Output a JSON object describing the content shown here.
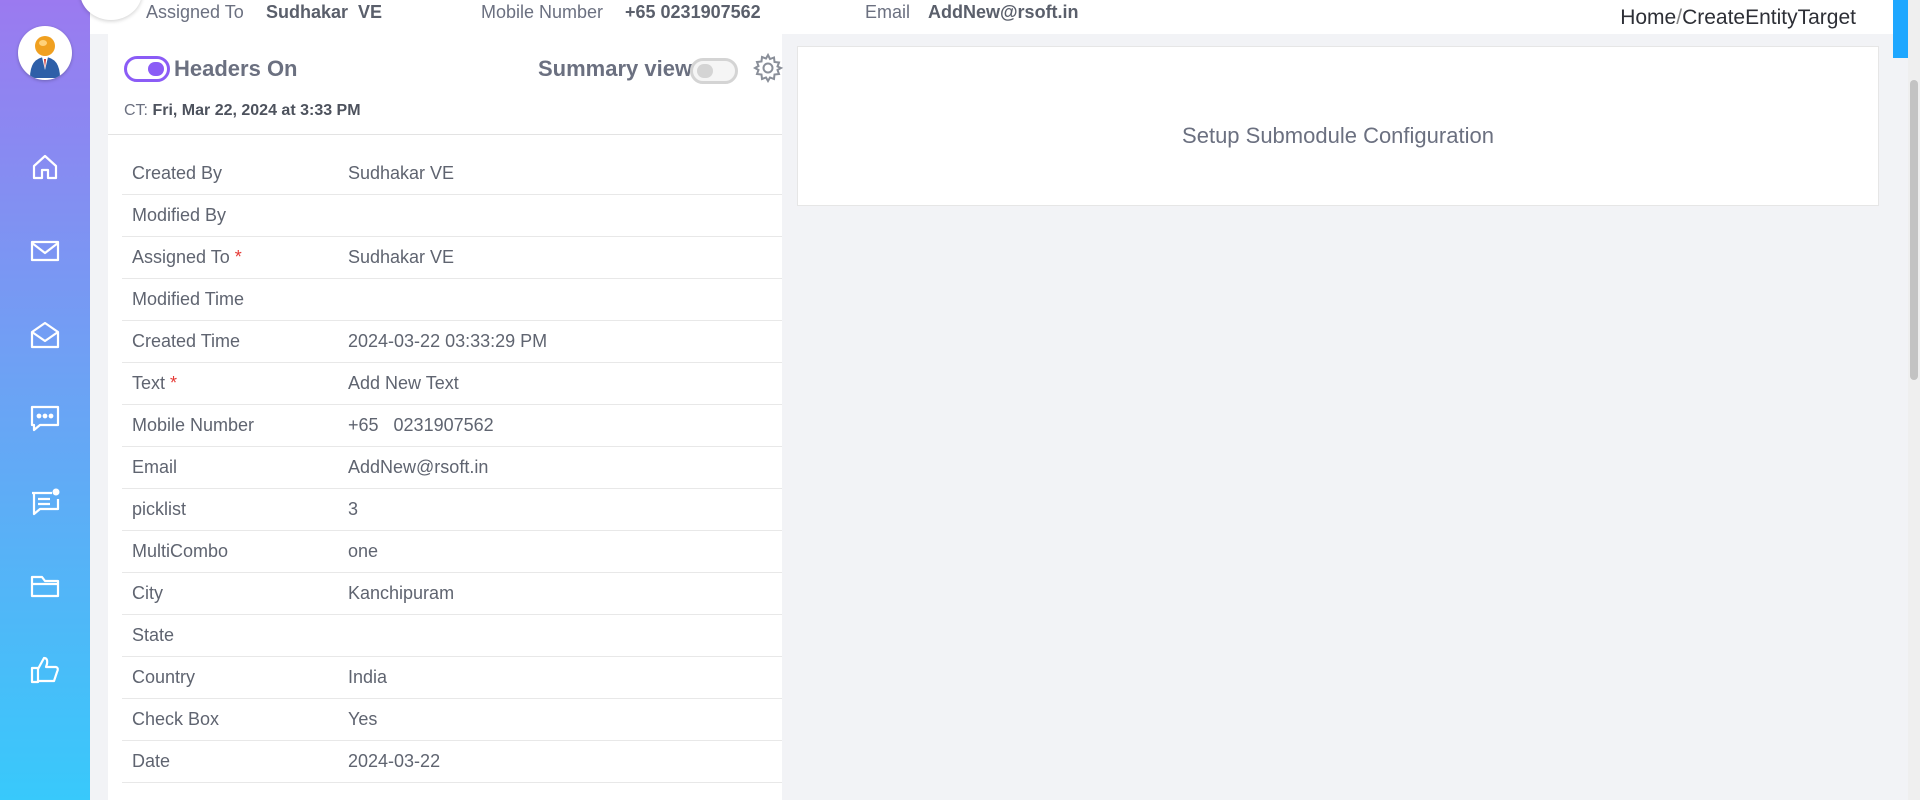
{
  "header": {
    "assigned_to_label": "Assigned To",
    "assigned_to_value": "Sudhakar  VE",
    "mobile_label": "Mobile Number",
    "mobile_value": "+65 0231907562",
    "email_label": "Email",
    "email_value": "AddNew@rsoft.in"
  },
  "breadcrumb": {
    "home": "Home",
    "separator": "/",
    "current": "CreateEntityTarget"
  },
  "controls": {
    "headers_label": "Headers On",
    "headers_on": true,
    "summary_label": "Summary view",
    "summary_on": false
  },
  "created_time": {
    "prefix": "CT:",
    "value": "Fri, Mar 22, 2024 at 3:33 PM"
  },
  "details": [
    {
      "label": "Created By",
      "value": "Sudhakar VE",
      "required": false
    },
    {
      "label": "Modified By",
      "value": "",
      "required": false
    },
    {
      "label": "Assigned To",
      "value": "Sudhakar VE",
      "required": true
    },
    {
      "label": "Modified Time",
      "value": "",
      "required": false
    },
    {
      "label": "Created Time",
      "value": "2024-03-22 03:33:29 PM",
      "required": false
    },
    {
      "label": "Text",
      "value": "Add New Text",
      "required": true
    },
    {
      "label": "Mobile Number",
      "value": "+65   0231907562",
      "required": false
    },
    {
      "label": "Email",
      "value": "AddNew@rsoft.in",
      "required": false
    },
    {
      "label": "picklist",
      "value": "3",
      "required": false
    },
    {
      "label": "MultiCombo",
      "value": "one",
      "required": false
    },
    {
      "label": "City",
      "value": "Kanchipuram",
      "required": false
    },
    {
      "label": "State",
      "value": "",
      "required": false
    },
    {
      "label": "Country",
      "value": "India",
      "required": false
    },
    {
      "label": "Check Box",
      "value": "Yes",
      "required": false
    },
    {
      "label": "Date",
      "value": "2024-03-22",
      "required": false
    }
  ],
  "submodule": {
    "message": "Setup Submodule Configuration"
  },
  "sidebar": {
    "icons": [
      "home-icon",
      "mail-icon",
      "mail-open-icon",
      "chat-icon",
      "notification-message-icon",
      "folder-icon",
      "thumbs-up-icon"
    ]
  },
  "colors": {
    "accent": "#8b5cf6",
    "sidebar_top": "#9b7af0",
    "sidebar_bottom": "#38c9fb",
    "required": "#e53935"
  }
}
